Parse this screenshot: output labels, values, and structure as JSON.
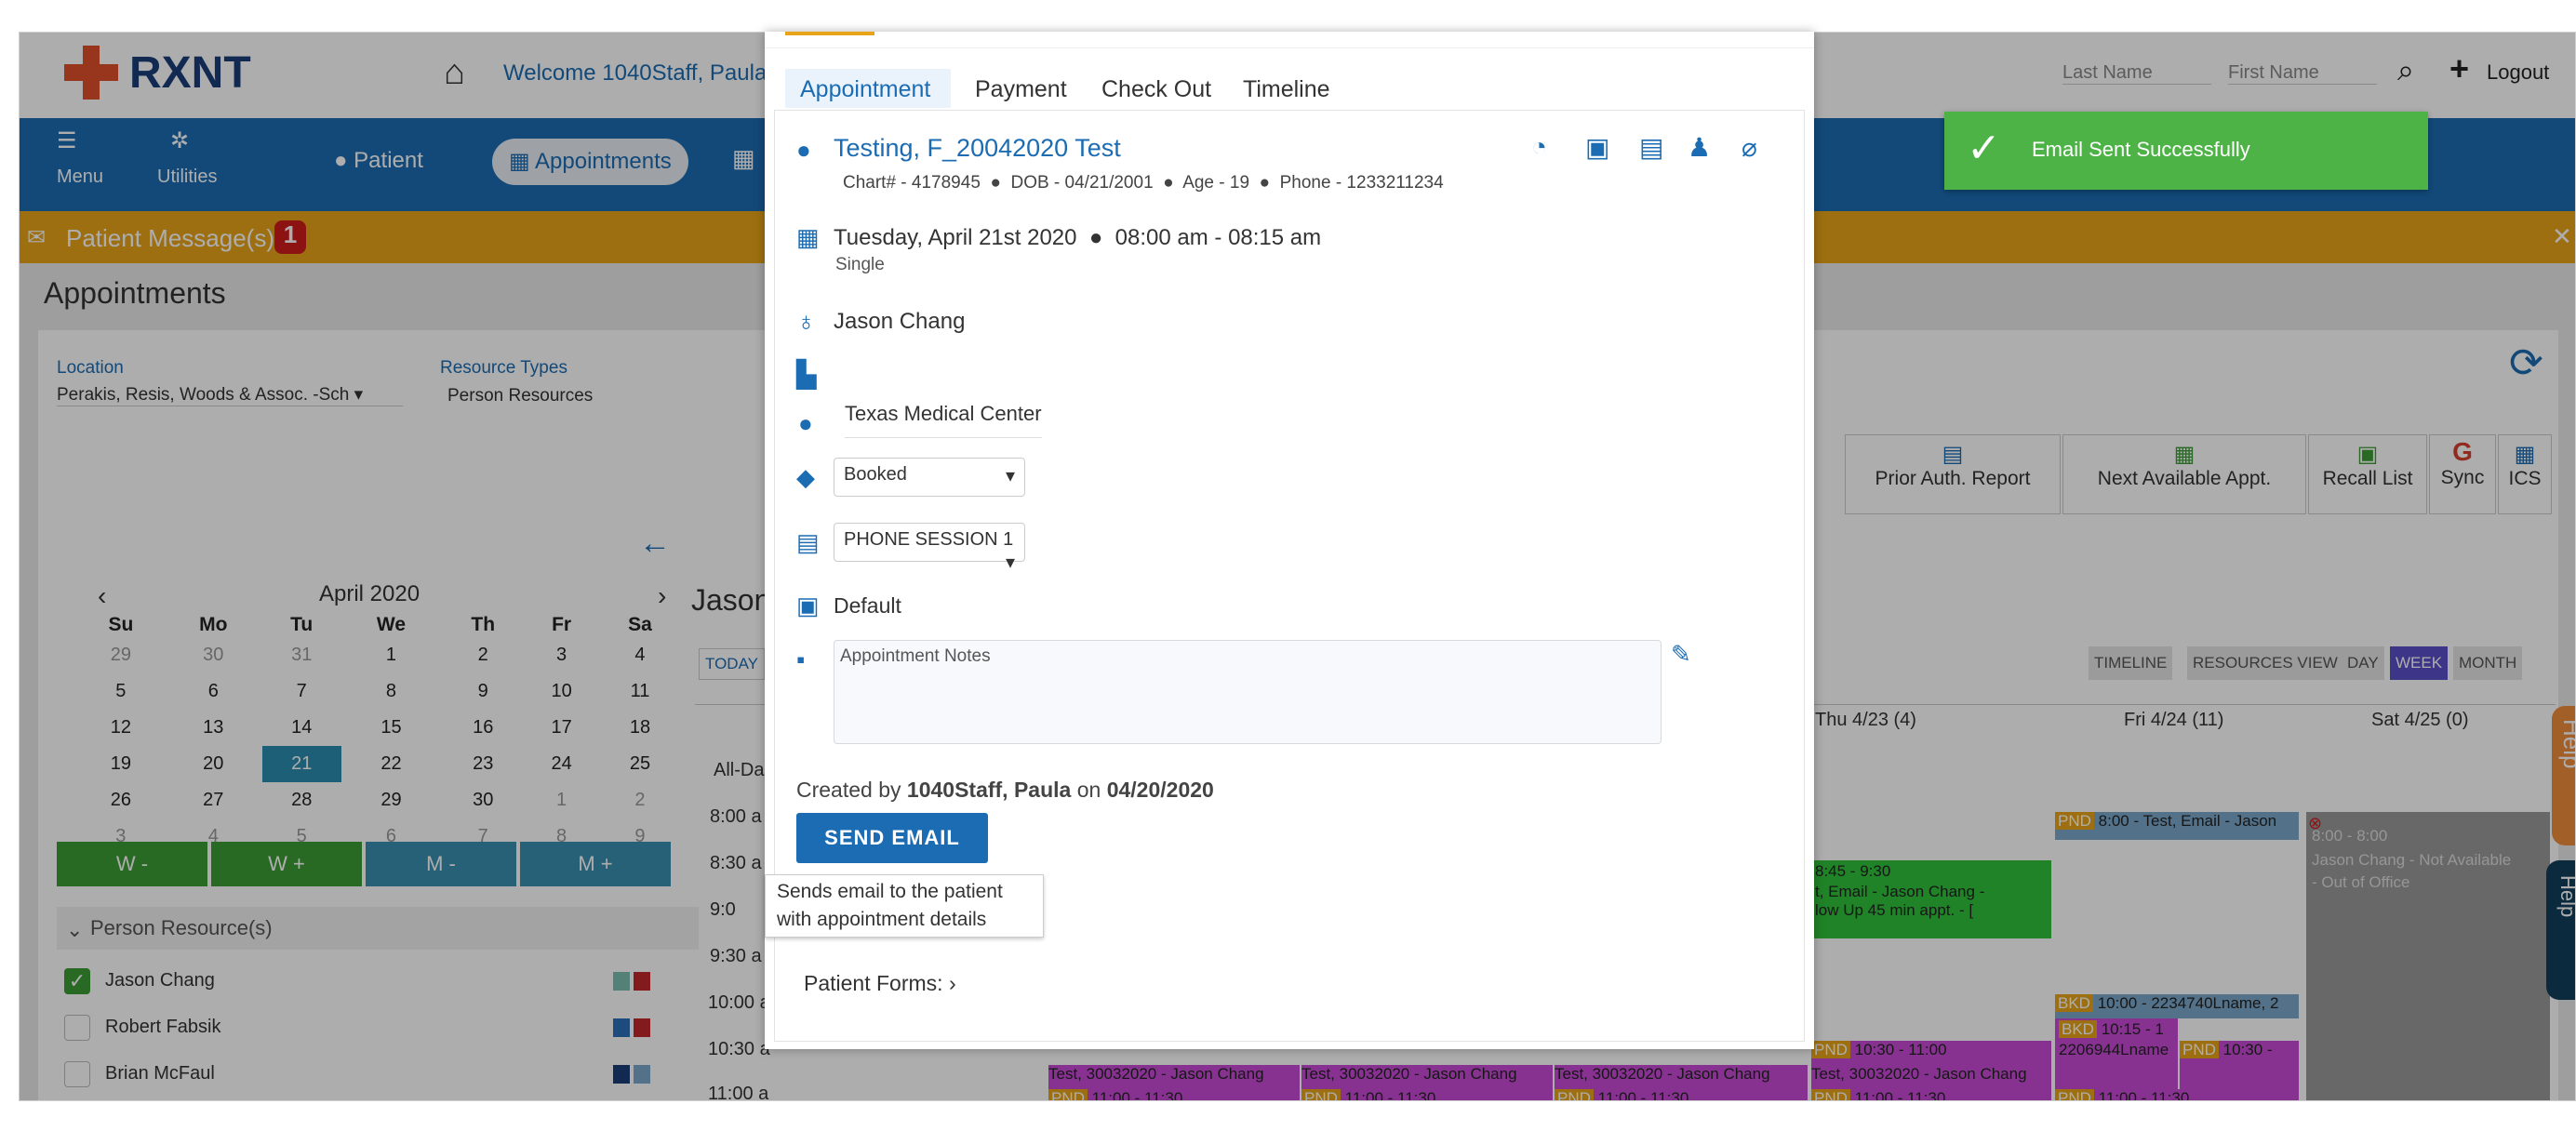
{
  "header": {
    "brand": "RXNT",
    "welcome": "Welcome 1040Staff, Paula",
    "last_name_placeholder": "Last Name",
    "first_name_placeholder": "First Name",
    "logout": "Logout"
  },
  "nav": {
    "menu": "Menu",
    "utilities": "Utilities",
    "patient": "Patient",
    "appointments": "Appointments"
  },
  "message_bar": {
    "label": "Patient Message(s)",
    "count": "1"
  },
  "page_title": "Appointments",
  "filters": {
    "location_label": "Location",
    "location_value": "Perakis, Resis, Woods & Assoc. -Sch",
    "resource_types_label": "Resource Types",
    "resource_types_value": "Person Resources"
  },
  "toolbar": {
    "prior_auth": "Prior Auth. Report",
    "next_available": "Next Available Appt.",
    "recall_list": "Recall List",
    "sync": "Sync",
    "ics": "ICS"
  },
  "calendar": {
    "month": "April 2020",
    "days": [
      "Su",
      "Mo",
      "Tu",
      "We",
      "Th",
      "Fr",
      "Sa"
    ],
    "weeks": [
      [
        "29",
        "30",
        "31",
        "1",
        "2",
        "3",
        "4"
      ],
      [
        "5",
        "6",
        "7",
        "8",
        "9",
        "10",
        "11"
      ],
      [
        "12",
        "13",
        "14",
        "15",
        "16",
        "17",
        "18"
      ],
      [
        "19",
        "20",
        "21",
        "22",
        "23",
        "24",
        "25"
      ],
      [
        "26",
        "27",
        "28",
        "29",
        "30",
        "1",
        "2"
      ],
      [
        "3",
        "4",
        "5",
        "6",
        "7",
        "8",
        "9"
      ]
    ],
    "week_buttons": [
      "W -",
      "W +",
      "M -",
      "M +"
    ]
  },
  "resources": {
    "header": "Person Resource(s)",
    "items": [
      "Jason Chang",
      "Robert Fabsik",
      "Brian McFaul"
    ]
  },
  "schedule": {
    "resource_title": "Jason",
    "today": "TODAY",
    "view_buttons": [
      "TIMELINE",
      "RESOURCES VIEW",
      "DAY",
      "WEEK",
      "MONTH"
    ],
    "columns": [
      "Thu 4/23 (4)",
      "Fri 4/24 (11)",
      "Sat 4/25 (0)"
    ],
    "times": [
      "All-Da",
      "8:00 a",
      "8:30 a",
      "9:0",
      "9:30 a",
      "10:00 a",
      "10:30 a",
      "11:00 a"
    ],
    "events": {
      "fri_8": "8:00 - Test, Email - Jason",
      "thu_845": "8:45 - 9:30",
      "thu_845_b": "t, Email - Jason Chang -",
      "thu_845_c": "low Up 45 min appt. - [",
      "sat_800": "8:00 - 8:00",
      "sat_na": "Jason Chang - Not Available",
      "sat_ooo": "- Out of Office",
      "fri_1000": "10:00 - 2234740Lname, 2",
      "fri_1015": "10:15 - 1",
      "fri_lname": "2206944Lname",
      "fri_1030": "10:30 -",
      "thu_1030": "10:30 - 11:00",
      "row_test": "Test, 30032020 - Jason Chang",
      "row_1100": "11:00 - 11:30",
      "pnd": "PND",
      "bkd": "BKD"
    }
  },
  "modal": {
    "tabs": [
      "Appointment",
      "Payment",
      "Check Out",
      "Timeline"
    ],
    "patient_name": "Testing, F_20042020 Test",
    "chart": "Chart# - 4178945",
    "dob": "DOB - 04/21/2001",
    "age": "Age - 19",
    "phone": "Phone - 1233211234",
    "date": "Tuesday, April 21st 2020",
    "time": "08:00 am - 08:15 am",
    "frequency": "Single",
    "provider": "Jason Chang",
    "location": "Texas Medical Center",
    "status": "Booked",
    "appointment_type": "PHONE SESSION 1",
    "case": "Default",
    "notes_placeholder": "Appointment Notes",
    "created_prefix": "Created by",
    "created_by": "1040Staff, Paula",
    "created_on_word": "on",
    "created_date": "04/20/2020",
    "send_email": "SEND EMAIL",
    "tooltip_line1": "Sends email to the patient",
    "tooltip_line2": "with appointment details",
    "patient_forms": "Patient Forms:"
  },
  "toast": {
    "message": "Email Sent Successfully"
  },
  "help": {
    "label": "Help"
  },
  "colors": {
    "brand_blue": "#1b6cb3",
    "message_orange": "#e8a419",
    "toast_green": "#4eb346",
    "calendar_green": "#3c9c35",
    "calendar_teal": "#3a8fb0"
  }
}
